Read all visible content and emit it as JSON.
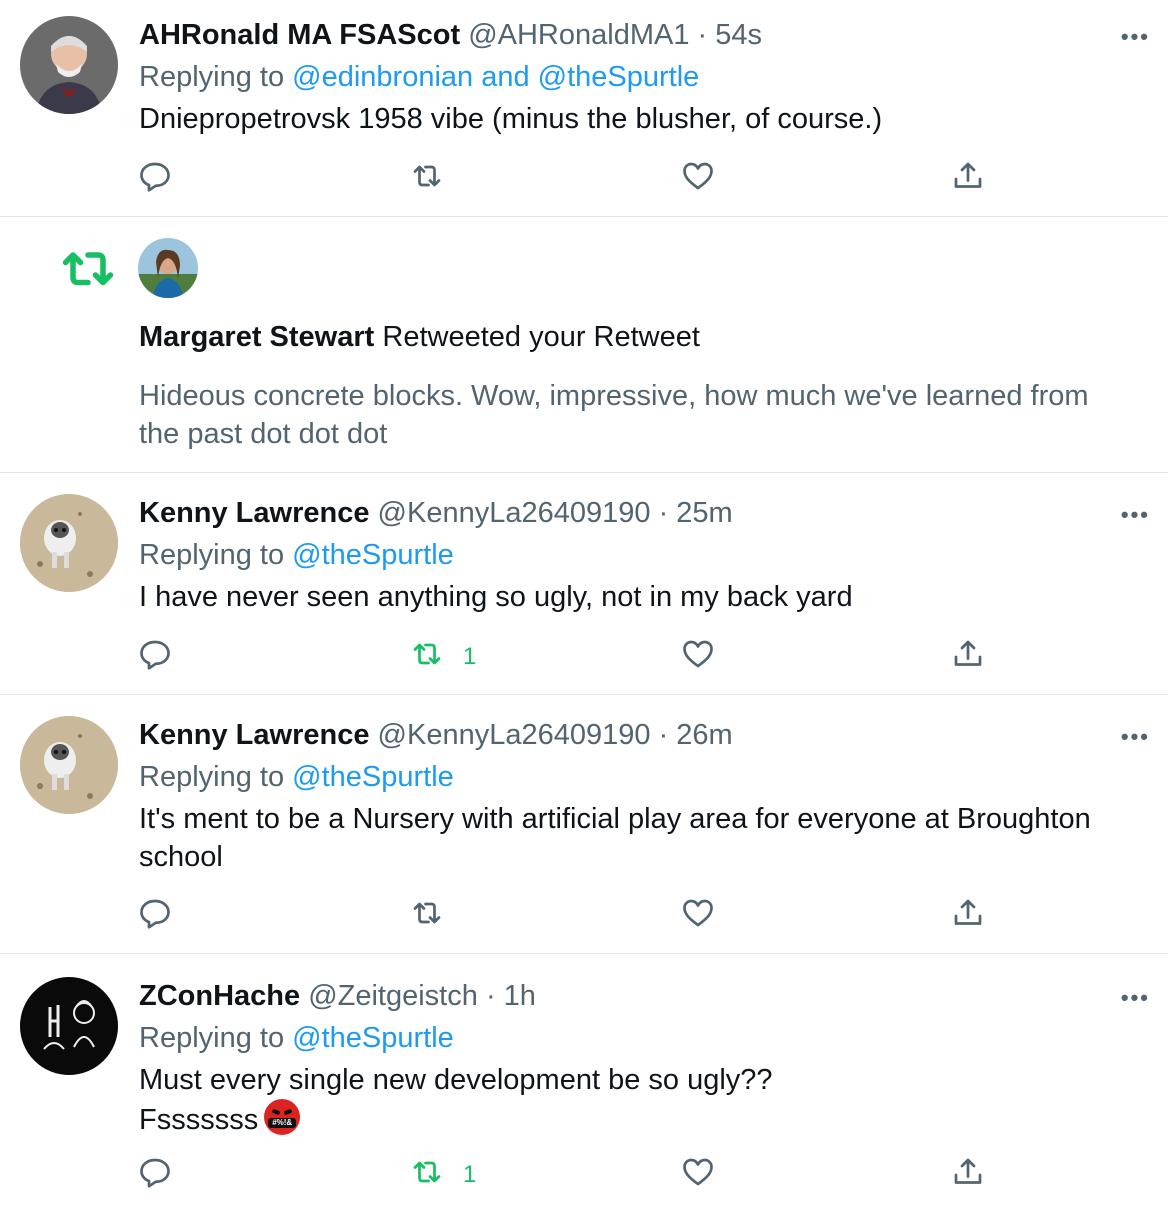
{
  "tweets": [
    {
      "name": "AHRonald MA FSAScot",
      "handle": "@AHRonaldMA1",
      "time": "54s",
      "replying_prefix": "Replying to",
      "replying_to": "@edinbronian and @theSpurtle",
      "text": "Dniepropetrovsk 1958 vibe (minus the blusher, of course.)",
      "retweets": ""
    },
    {
      "name": "Kenny Lawrence",
      "handle": "@KennyLa26409190",
      "time": "25m",
      "replying_prefix": "Replying to",
      "replying_to": "@theSpurtle",
      "text": "I have never seen anything so ugly, not in my back yard",
      "retweets": "1"
    },
    {
      "name": "Kenny Lawrence",
      "handle": "@KennyLa26409190",
      "time": "26m",
      "replying_prefix": "Replying to",
      "replying_to": "@theSpurtle",
      "text_line1": "It's ment to be a Nursery with artificial play area for everyone at Broughton",
      "text_line2": "school",
      "retweets": ""
    },
    {
      "name": "ZConHache",
      "handle": "@Zeitgeistch",
      "time": "1h",
      "replying_prefix": "Replying to",
      "replying_to": "@theSpurtle",
      "text_line1": "Must every single new development be so ugly??",
      "text_line2": "Fsssssss",
      "emoji_label": "#%!&",
      "retweets": "1"
    }
  ],
  "notification": {
    "name": "Margaret Stewart",
    "action": "Retweeted your Retweet",
    "quoted_text_line1": "Hideous concrete blocks. Wow, impressive, how much we've learned from",
    "quoted_text_line2": "the past dot dot dot"
  },
  "separator": "·",
  "more_label": "•••",
  "colors": {
    "link": "#1d9bf0",
    "retweet_green": "#17bf63",
    "secondary": "#536471"
  },
  "icons": [
    "reply-icon",
    "retweet-icon",
    "like-icon",
    "share-icon",
    "more-icon"
  ]
}
